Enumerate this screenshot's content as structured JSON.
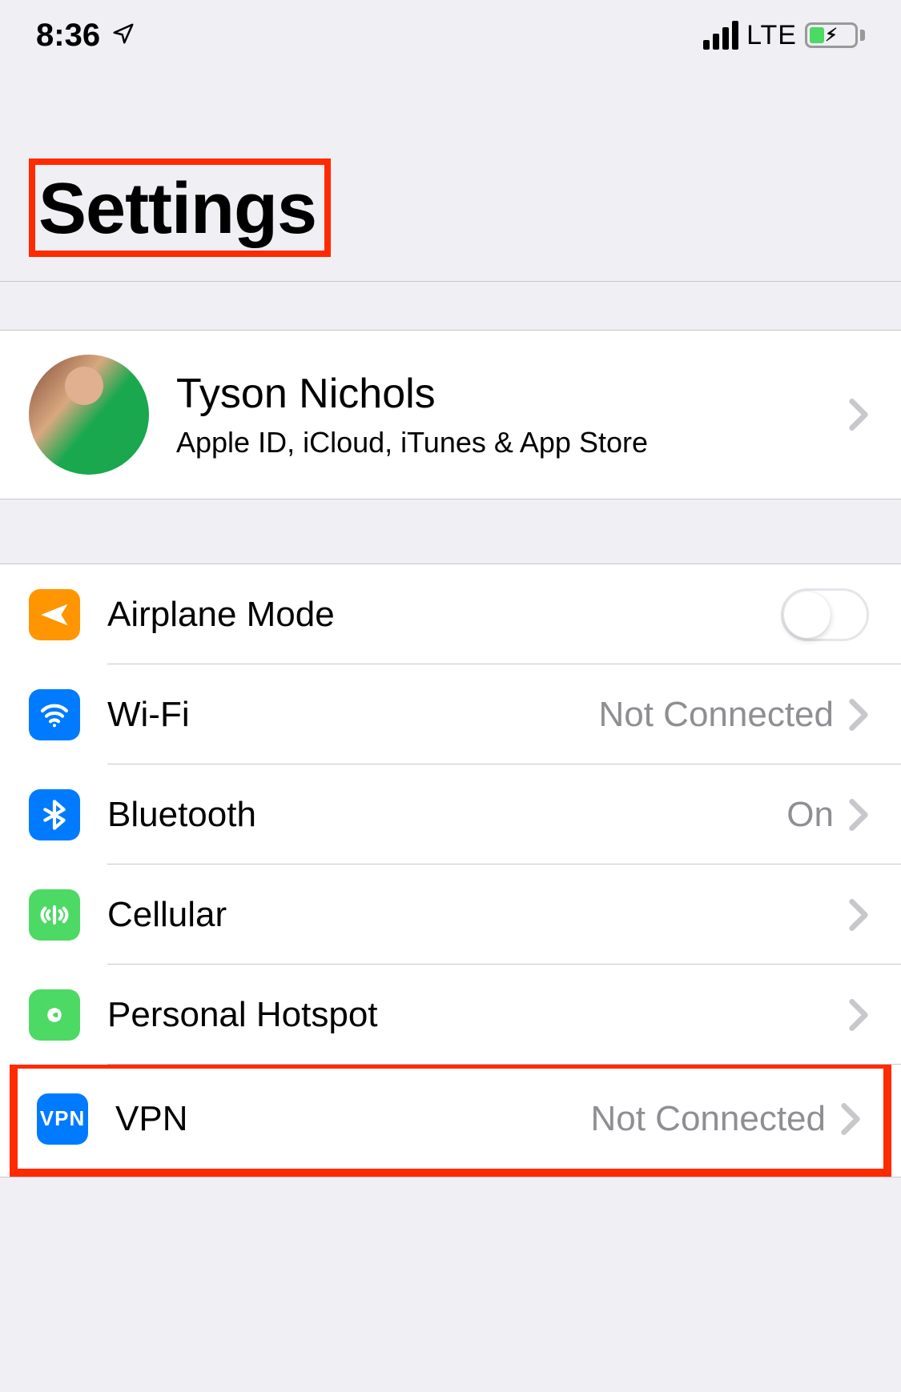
{
  "status_bar": {
    "time": "8:36",
    "network": "LTE"
  },
  "title": "Settings",
  "apple_id": {
    "name": "Tyson Nichols",
    "subtitle": "Apple ID, iCloud, iTunes & App Store"
  },
  "rows": {
    "airplane": {
      "label": "Airplane Mode"
    },
    "wifi": {
      "label": "Wi-Fi",
      "detail": "Not Connected"
    },
    "bluetooth": {
      "label": "Bluetooth",
      "detail": "On"
    },
    "cellular": {
      "label": "Cellular"
    },
    "hotspot": {
      "label": "Personal Hotspot"
    },
    "vpn": {
      "label": "VPN",
      "detail": "Not Connected",
      "icon_text": "VPN"
    }
  },
  "annotations": {
    "title_highlighted": true,
    "vpn_row_highlighted": true
  }
}
